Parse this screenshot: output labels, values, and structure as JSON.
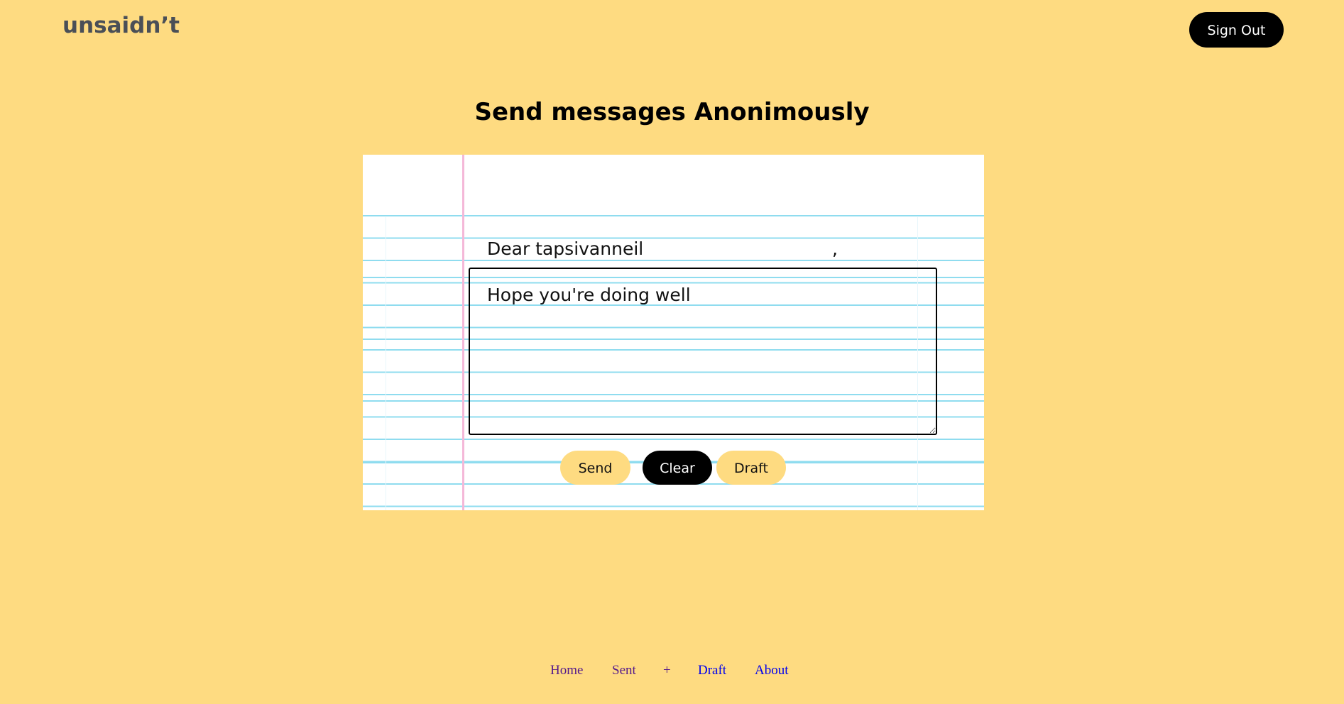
{
  "header": {
    "logo": "unsaidn’t",
    "sign_out_label": "Sign Out"
  },
  "main": {
    "title": "Send messages Anonimously",
    "salutation": "Dear tapsivanneil",
    "salutation_comma": ",",
    "message_value": "Hope you're doing well",
    "buttons": {
      "send": "Send",
      "clear": "Clear",
      "draft": "Draft"
    }
  },
  "footer": {
    "links": [
      "Home",
      "Sent",
      "+",
      "Draft",
      "About"
    ]
  },
  "colors": {
    "background": "#fedb81",
    "paper": "#ffffff",
    "ruled_line": "#8fdcef",
    "margin_line": "#f4b8d8",
    "dark_button": "#000000",
    "visited_link": "#551a8b",
    "link": "#0000ee"
  }
}
